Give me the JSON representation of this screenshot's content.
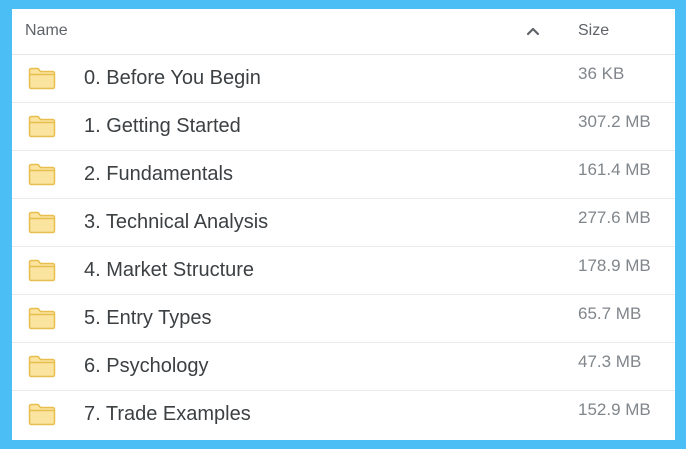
{
  "colors": {
    "frame": "#4bbff5",
    "folder_fill": "#fbe3a0",
    "folder_stroke": "#e8bf4f",
    "text_primary": "#3c4043",
    "text_secondary": "#80868b"
  },
  "header": {
    "name_label": "Name",
    "size_label": "Size",
    "sort_icon": "chevron-up-icon"
  },
  "rows": [
    {
      "name": "0. Before You Begin",
      "size": "36 KB",
      "icon": "folder-icon"
    },
    {
      "name": "1. Getting Started",
      "size": "307.2 MB",
      "icon": "folder-icon"
    },
    {
      "name": "2. Fundamentals",
      "size": "161.4 MB",
      "icon": "folder-icon"
    },
    {
      "name": "3. Technical Analysis",
      "size": "277.6 MB",
      "icon": "folder-icon"
    },
    {
      "name": "4. Market Structure",
      "size": "178.9 MB",
      "icon": "folder-icon"
    },
    {
      "name": "5. Entry Types",
      "size": "65.7 MB",
      "icon": "folder-icon"
    },
    {
      "name": "6. Psychology",
      "size": "47.3 MB",
      "icon": "folder-icon"
    },
    {
      "name": "7. Trade Examples",
      "size": "152.9 MB",
      "icon": "folder-icon"
    }
  ]
}
